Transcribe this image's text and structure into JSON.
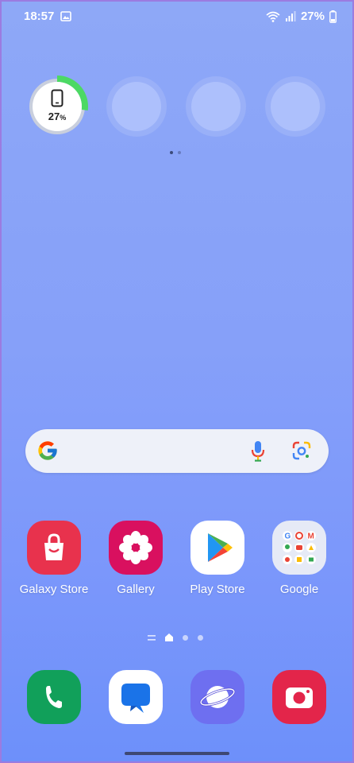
{
  "status_bar": {
    "time": "18:57",
    "battery_text": "27%",
    "icons": [
      "gallery-icon",
      "wifi-icon",
      "signal-icon",
      "battery-icon"
    ]
  },
  "battery_widget": {
    "percent_value": "27",
    "percent_sign": "%",
    "level": 0.27,
    "ring_color": "#4cd964"
  },
  "search_bar": {
    "icons": [
      "google-g-icon",
      "microphone-icon",
      "google-lens-icon"
    ]
  },
  "apps": [
    {
      "label": "Galaxy Store",
      "icon": "galaxy-store-icon",
      "color": "#e8324d"
    },
    {
      "label": "Gallery",
      "icon": "gallery-flower-icon",
      "color": "#d9105f"
    },
    {
      "label": "Play Store",
      "icon": "play-store-icon",
      "color": "#ffffff"
    },
    {
      "label": "Google",
      "icon": "google-folder-icon",
      "color": "#e6eaf6"
    }
  ],
  "dock": [
    {
      "icon": "phone-icon",
      "color": "#11a05a"
    },
    {
      "icon": "messages-icon",
      "color": "#ffffff"
    },
    {
      "icon": "internet-icon",
      "color": "#6e6ff0"
    },
    {
      "icon": "camera-icon",
      "color": "#e3254a"
    }
  ]
}
